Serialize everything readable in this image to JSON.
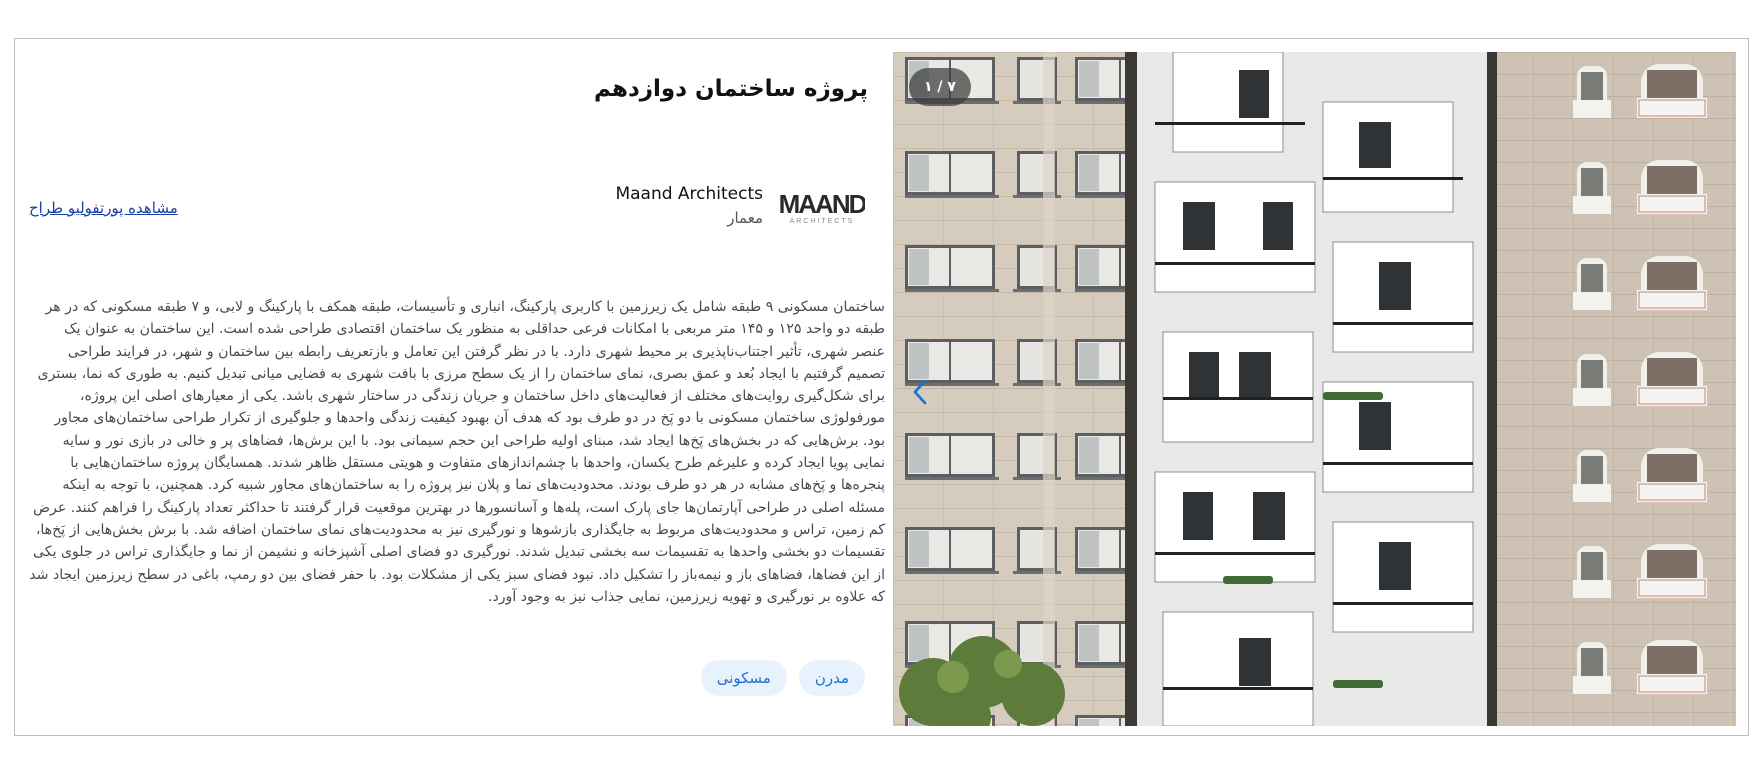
{
  "project": {
    "title": "پروژه ساختمان دوازدهم",
    "architect": {
      "name": "Maand Architects",
      "role": "معمار",
      "logo_text": "MAAND",
      "logo_subtext": "ARCHITECTS"
    },
    "portfolio_link": "مشاهده پورتفولیو طراح",
    "description": "ساختمان مسکونی ۹ طبقه شامل یک زیرزمین با کاربری پارکینگ، انباری و تأسیسات، طبقه همکف با پارکینگ و لابی، و ۷ طبقه مسکونی که در هر طبقه دو واحد ۱۲۵ و ۱۴۵ متر مربعی با امکانات فرعی حداقلی به منظور یک ساختمان اقتصادی طراحی شده است. این ساختمان به عنوان یک عنصر شهری، تأثیر اجتناب‌ناپذیری بر محیط شهری دارد. با در نظر گرفتن این تعامل و بازتعریف رابطه بین ساختمان و شهر، در فرایند طراحی تصمیم گرفتیم با ایجاد بُعد و عمق بصری، نمای ساختمان را از یک سطح مرزی با بافت شهری به فضایی میانی تبدیل کنیم. به طوری که نما، بستری برای شکل‌گیری روایت‌های مختلف از فعالیت‌های داخل ساختمان و جریان زندگی در ساختار شهری باشد. یکی از معیارهای اصلی این پروژه، مورفولوژی ساختمان مسکونی با دو پَخ در دو طرف بود که هدف آن بهبود کیفیت زندگی واحدها و جلوگیری از تکرار طراحی ساختمان‌های مجاور بود. برش‌هایی که در بخش‌های پَخ‌ها ایجاد شد، مبنای اولیه طراحی این حجم سیمانی بود. با این برش‌ها، فضاهای پر و خالی در بازی نور و سایه نمایی پویا ایجاد کرده و علیرغم طرح یکسان، واحدها با چشم‌اندازهای متفاوت و هویتی مستقل ظاهر شدند. همسایگان پروژه ساختمان‌هایی با پنجره‌ها و پَخ‌های مشابه در هر دو طرف بودند. محدودیت‌های نما و پلان نیز پروژه را به ساختمان‌های مجاور شبیه کرد. همچنین، با توجه به اینکه مسئله اصلی در طراحی آپارتمان‌ها جای پارک است، پله‌ها و آسانسورها در بهترین موقعیت قرار گرفتند تا حداکثر تعداد پارکینگ را فراهم کنند. عرض کم زمین، تراس و محدودیت‌های مربوط به جایگذاری بازشوها و نورگیری نیز به محدودیت‌های نمای ساختمان اضافه شد. با برش بخش‌هایی از پَخ‌ها، تقسیمات دو بخشی واحدها به تقسیمات سه بخشی تبدیل شدند. نورگیری دو فضای اصلی آشپزخانه و نشیمن از نما و جایگذاری تراس در جلوی یکی از این فضاها، فضاهای باز و نیمه‌باز را تشکیل داد. نبود فضای سبز یکی از مشکلات بود. با حفر فضای بین دو رمپ، باغی در سطح زیرزمین ایجاد شد که علاوه بر نورگیری و تهویه زیرزمین، نمایی جذاب نیز به وجود آورد.",
    "tags": [
      "مدرن",
      "مسکونی"
    ]
  },
  "gallery": {
    "counter": "۱ / ۷",
    "prev_icon": "chevron-left-icon",
    "accent_color": "#1e6fd0"
  }
}
